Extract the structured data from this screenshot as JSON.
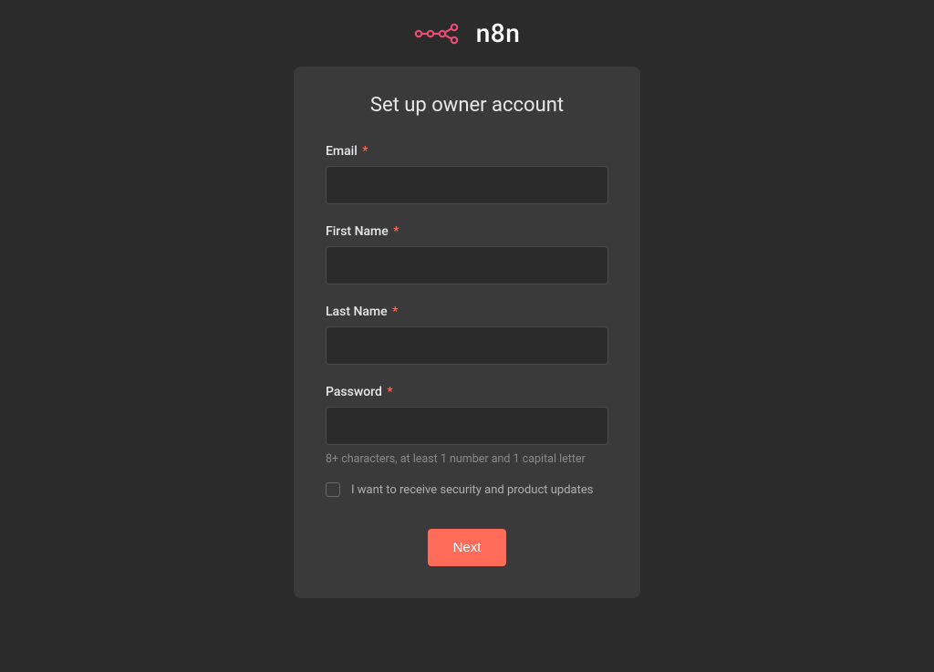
{
  "logo": {
    "text": "n8n",
    "iconColor": "#ea4b71"
  },
  "card": {
    "title": "Set up owner account"
  },
  "form": {
    "email": {
      "label": "Email",
      "required": "*",
      "value": ""
    },
    "firstName": {
      "label": "First Name",
      "required": "*",
      "value": ""
    },
    "lastName": {
      "label": "Last Name",
      "required": "*",
      "value": ""
    },
    "password": {
      "label": "Password",
      "required": "*",
      "value": "",
      "hint": "8+ characters, at least 1 number and 1 capital letter"
    },
    "updates": {
      "label": "I want to receive security and product updates",
      "checked": false
    },
    "submitLabel": "Next"
  }
}
